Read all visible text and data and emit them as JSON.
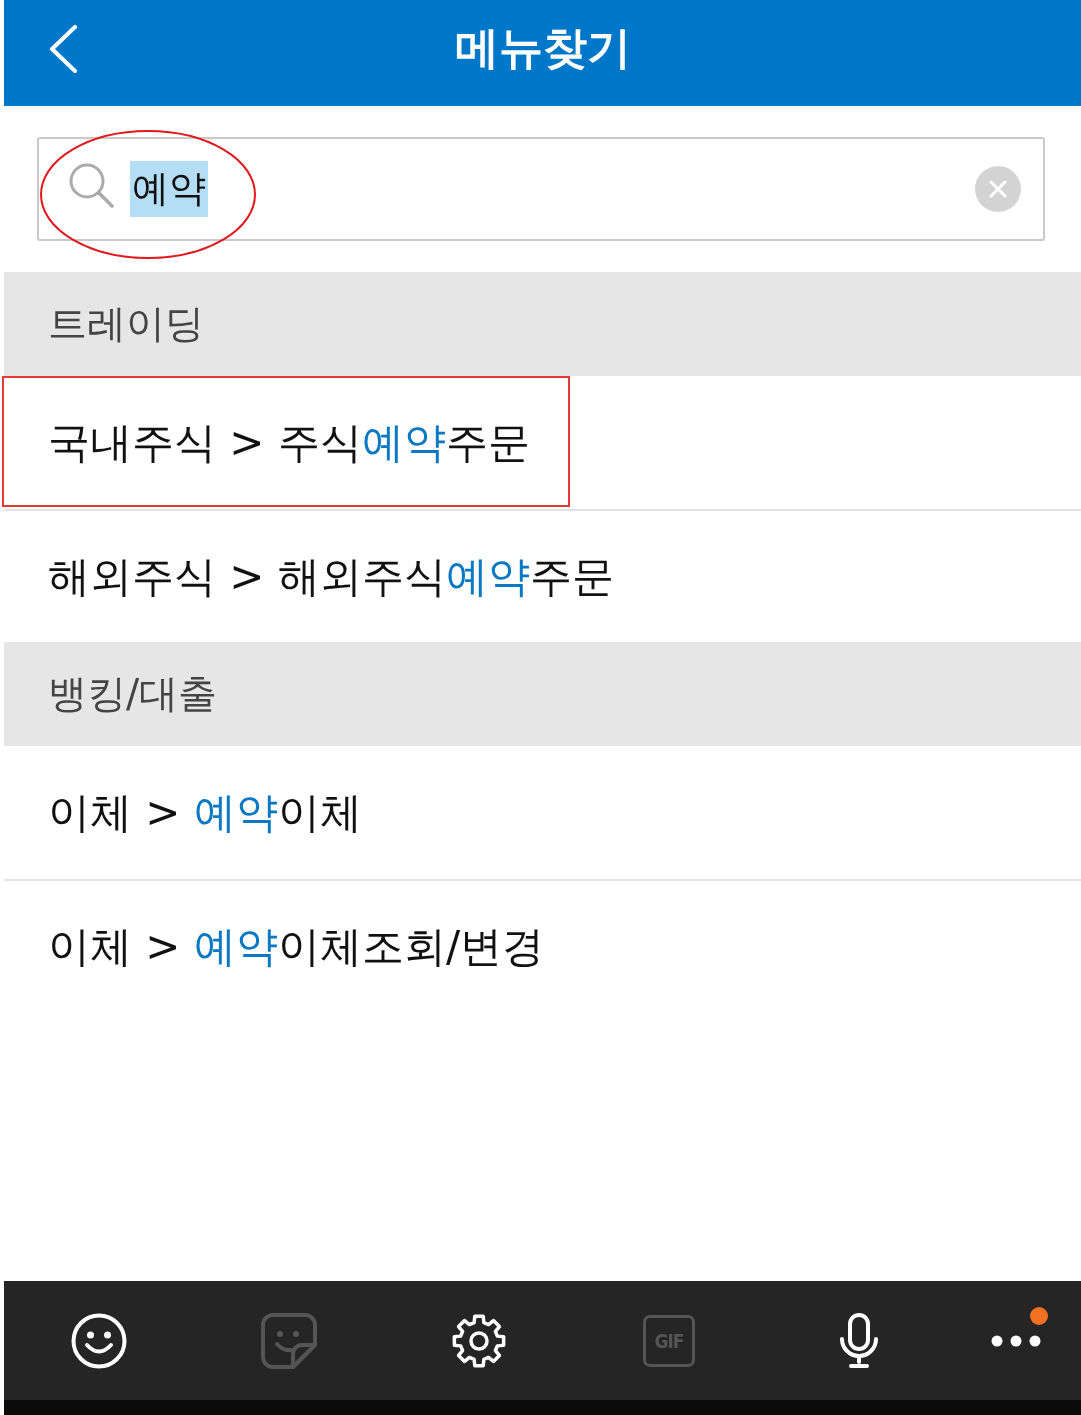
{
  "header": {
    "title": "메뉴찾기"
  },
  "search": {
    "value": "예약",
    "value_selected": true,
    "circled": true
  },
  "sections": [
    {
      "title": "트레이딩",
      "results": [
        {
          "parts": [
            {
              "text": "국내주식 > 주식",
              "match": false
            },
            {
              "text": "예약",
              "match": true
            },
            {
              "text": "주문",
              "match": false
            }
          ],
          "boxed": true
        },
        {
          "parts": [
            {
              "text": "해외주식 > 해외주식",
              "match": false
            },
            {
              "text": "예약",
              "match": true
            },
            {
              "text": "주문",
              "match": false
            }
          ],
          "boxed": false
        }
      ]
    },
    {
      "title": "뱅킹/대출",
      "results": [
        {
          "parts": [
            {
              "text": "이체 > ",
              "match": false
            },
            {
              "text": "예약",
              "match": true
            },
            {
              "text": "이체",
              "match": false
            }
          ],
          "boxed": false
        },
        {
          "parts": [
            {
              "text": "이체 > ",
              "match": false
            },
            {
              "text": "예약",
              "match": true
            },
            {
              "text": "이체조회/변경",
              "match": false
            }
          ],
          "boxed": false
        }
      ]
    }
  ],
  "keyboard_toolbar": {
    "tools": [
      {
        "kind": "emoji",
        "disabled": false,
        "badge": false
      },
      {
        "kind": "sticker",
        "disabled": true,
        "badge": false
      },
      {
        "kind": "settings",
        "disabled": false,
        "badge": false
      },
      {
        "kind": "gif",
        "label": "GIF",
        "disabled": true,
        "badge": false
      },
      {
        "kind": "mic",
        "disabled": false,
        "badge": false
      },
      {
        "kind": "more",
        "disabled": false,
        "badge": true
      }
    ]
  }
}
